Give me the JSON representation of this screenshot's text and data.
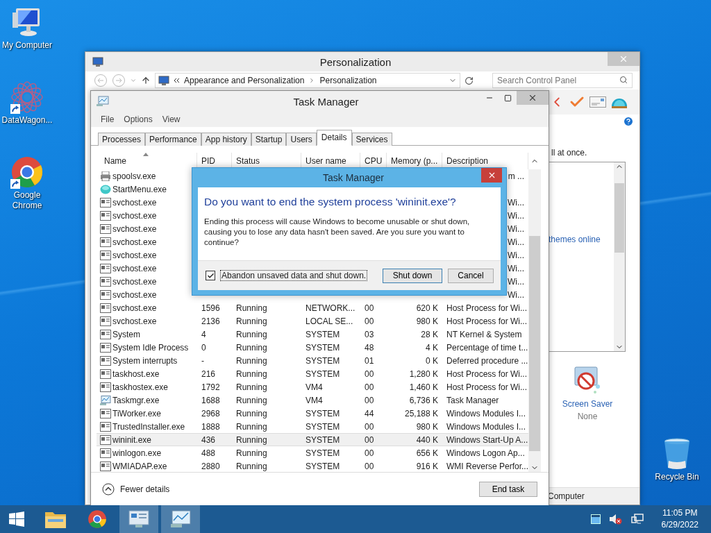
{
  "desktop_icons": [
    {
      "label": "My Computer",
      "kind": "computer",
      "shortcut": false
    },
    {
      "label": "DataWagon...",
      "kind": "mandala",
      "shortcut": true
    },
    {
      "label": "Google Chrome",
      "kind": "chrome",
      "shortcut": true
    }
  ],
  "recycle_bin": {
    "label": "Recycle Bin"
  },
  "control_panel": {
    "title": "Personalization",
    "breadcrumb": [
      "Appearance and Personalization",
      "Personalization"
    ],
    "search": {
      "placeholder": "Search Control Panel"
    },
    "text_fragment": "ll at once.",
    "link": "themes online",
    "screen_saver": {
      "label": "Screen Saver",
      "value": "None"
    },
    "footer_fragment": "Computer"
  },
  "task_manager": {
    "title": "Task Manager",
    "menu": [
      "File",
      "Options",
      "View"
    ],
    "tabs": [
      {
        "label": "Processes",
        "selected": false
      },
      {
        "label": "Performance",
        "selected": false
      },
      {
        "label": "App history",
        "selected": false
      },
      {
        "label": "Startup",
        "selected": false
      },
      {
        "label": "Users",
        "selected": false
      },
      {
        "label": "Details",
        "selected": true
      },
      {
        "label": "Services",
        "selected": false
      }
    ],
    "columns": [
      "Name",
      "PID",
      "Status",
      "User name",
      "CPU",
      "Memory (p...",
      "Description"
    ],
    "rows": [
      {
        "kind": "printer",
        "name": "spoolsv.exe",
        "description": "m ...",
        "selected": false
      },
      {
        "kind": "orb",
        "name": "StartMenu.exe",
        "selected": false
      },
      {
        "kind": "service",
        "name": "svchost.exe",
        "description": "Wi...",
        "selected": false
      },
      {
        "kind": "service",
        "name": "svchost.exe",
        "description": "Wi...",
        "selected": false
      },
      {
        "kind": "service",
        "name": "svchost.exe",
        "description": "Wi...",
        "selected": false
      },
      {
        "kind": "service",
        "name": "svchost.exe",
        "description": "Wi...",
        "selected": false
      },
      {
        "kind": "service",
        "name": "svchost.exe",
        "description": "Wi...",
        "selected": false
      },
      {
        "kind": "service",
        "name": "svchost.exe",
        "description": "Wi...",
        "selected": false
      },
      {
        "kind": "service",
        "name": "svchost.exe",
        "description": "Wi...",
        "selected": false
      },
      {
        "kind": "service",
        "name": "svchost.exe",
        "description": "Wi...",
        "selected": false
      },
      {
        "kind": "service",
        "name": "svchost.exe",
        "pid": "1596",
        "status": "Running",
        "user": "NETWORK...",
        "cpu": "00",
        "memory": "620 K",
        "description": "Host Process for Wi...",
        "selected": false
      },
      {
        "kind": "service",
        "name": "svchost.exe",
        "pid": "2136",
        "status": "Running",
        "user": "LOCAL SE...",
        "cpu": "00",
        "memory": "980 K",
        "description": "Host Process for Wi...",
        "selected": false
      },
      {
        "kind": "service",
        "name": "System",
        "pid": "4",
        "status": "Running",
        "user": "SYSTEM",
        "cpu": "03",
        "memory": "28 K",
        "description": "NT Kernel & System",
        "selected": false
      },
      {
        "kind": "service",
        "name": "System Idle Process",
        "pid": "0",
        "status": "Running",
        "user": "SYSTEM",
        "cpu": "48",
        "memory": "4 K",
        "description": "Percentage of time t...",
        "selected": false
      },
      {
        "kind": "service",
        "name": "System interrupts",
        "pid": "-",
        "status": "Running",
        "user": "SYSTEM",
        "cpu": "01",
        "memory": "0 K",
        "description": "Deferred procedure ...",
        "selected": false
      },
      {
        "kind": "service",
        "name": "taskhost.exe",
        "pid": "216",
        "status": "Running",
        "user": "SYSTEM",
        "cpu": "00",
        "memory": "1,280 K",
        "description": "Host Process for Wi...",
        "selected": false
      },
      {
        "kind": "service",
        "name": "taskhostex.exe",
        "pid": "1792",
        "status": "Running",
        "user": "VM4",
        "cpu": "00",
        "memory": "1,460 K",
        "description": "Host Process for Wi...",
        "selected": false
      },
      {
        "kind": "monitor",
        "name": "Taskmgr.exe",
        "pid": "1688",
        "status": "Running",
        "user": "VM4",
        "cpu": "00",
        "memory": "6,736 K",
        "description": "Task Manager",
        "selected": false
      },
      {
        "kind": "service",
        "name": "TiWorker.exe",
        "pid": "2968",
        "status": "Running",
        "user": "SYSTEM",
        "cpu": "44",
        "memory": "25,188 K",
        "description": "Windows Modules I...",
        "selected": false
      },
      {
        "kind": "service",
        "name": "TrustedInstaller.exe",
        "pid": "1888",
        "status": "Running",
        "user": "SYSTEM",
        "cpu": "00",
        "memory": "980 K",
        "description": "Windows Modules I...",
        "selected": false
      },
      {
        "kind": "service",
        "name": "wininit.exe",
        "pid": "436",
        "status": "Running",
        "user": "SYSTEM",
        "cpu": "00",
        "memory": "440 K",
        "description": "Windows Start-Up A...",
        "selected": true
      },
      {
        "kind": "service",
        "name": "winlogon.exe",
        "pid": "488",
        "status": "Running",
        "user": "SYSTEM",
        "cpu": "00",
        "memory": "656 K",
        "description": "Windows Logon Ap...",
        "selected": false
      },
      {
        "kind": "service",
        "name": "WMIADAP.exe",
        "pid": "2880",
        "status": "Running",
        "user": "SYSTEM",
        "cpu": "00",
        "memory": "916 K",
        "description": "WMI Reverse Perfor...",
        "selected": false
      }
    ],
    "fewer_details": "Fewer details",
    "end_task": "End task"
  },
  "dialog": {
    "title": "Task Manager",
    "heading": "Do you want to end the system process 'wininit.exe'?",
    "body": "Ending this process will cause Windows to become unusable or shut down, causing you to lose any data hasn't been saved. Are you sure you want to continue?",
    "checkbox": {
      "label": "Abandon unsaved data and shut down.",
      "checked": true
    },
    "buttons": [
      {
        "label": "Shut down",
        "default": true
      },
      {
        "label": "Cancel",
        "default": false
      }
    ]
  },
  "taskbar": {
    "apps": [
      {
        "kind": "folder",
        "active": false
      },
      {
        "kind": "chrome",
        "active": false
      },
      {
        "kind": "control_panel",
        "active": true
      },
      {
        "kind": "taskmgr",
        "active": true
      }
    ],
    "time": "11:05 PM",
    "date": "6/29/2022"
  }
}
